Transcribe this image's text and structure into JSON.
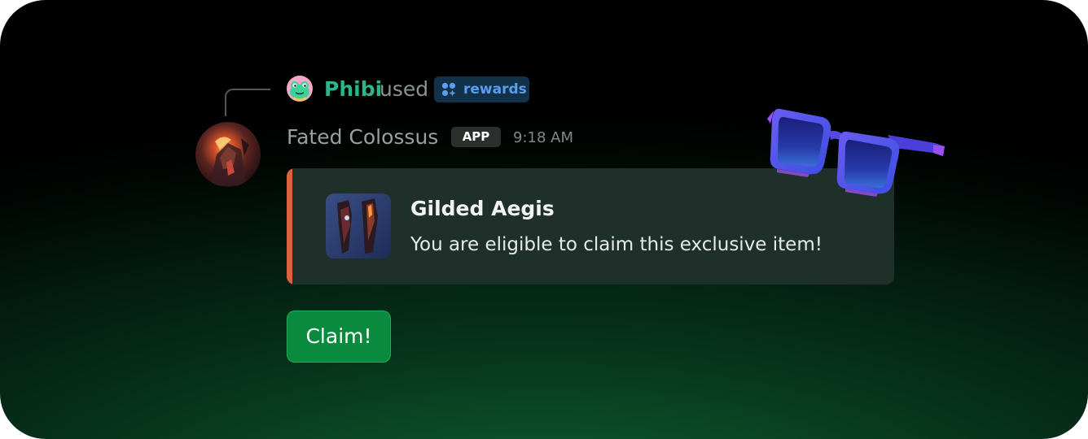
{
  "reply": {
    "user_name": "Phibi",
    "action_text": "used",
    "command_label": "rewards"
  },
  "message": {
    "author_name": "Fated Colossus",
    "badge": "APP",
    "timestamp": "9:18 AM"
  },
  "embed": {
    "title": "Gilded Aegis",
    "description": "You are eligible to claim this exclusive item!",
    "accent_color": "#e0603d"
  },
  "actions": {
    "claim_label": "Claim!"
  },
  "icons": {
    "reply_avatar": "frog-avatar-icon",
    "command": "app-command-icon",
    "decoration": "sunglasses-icon"
  }
}
